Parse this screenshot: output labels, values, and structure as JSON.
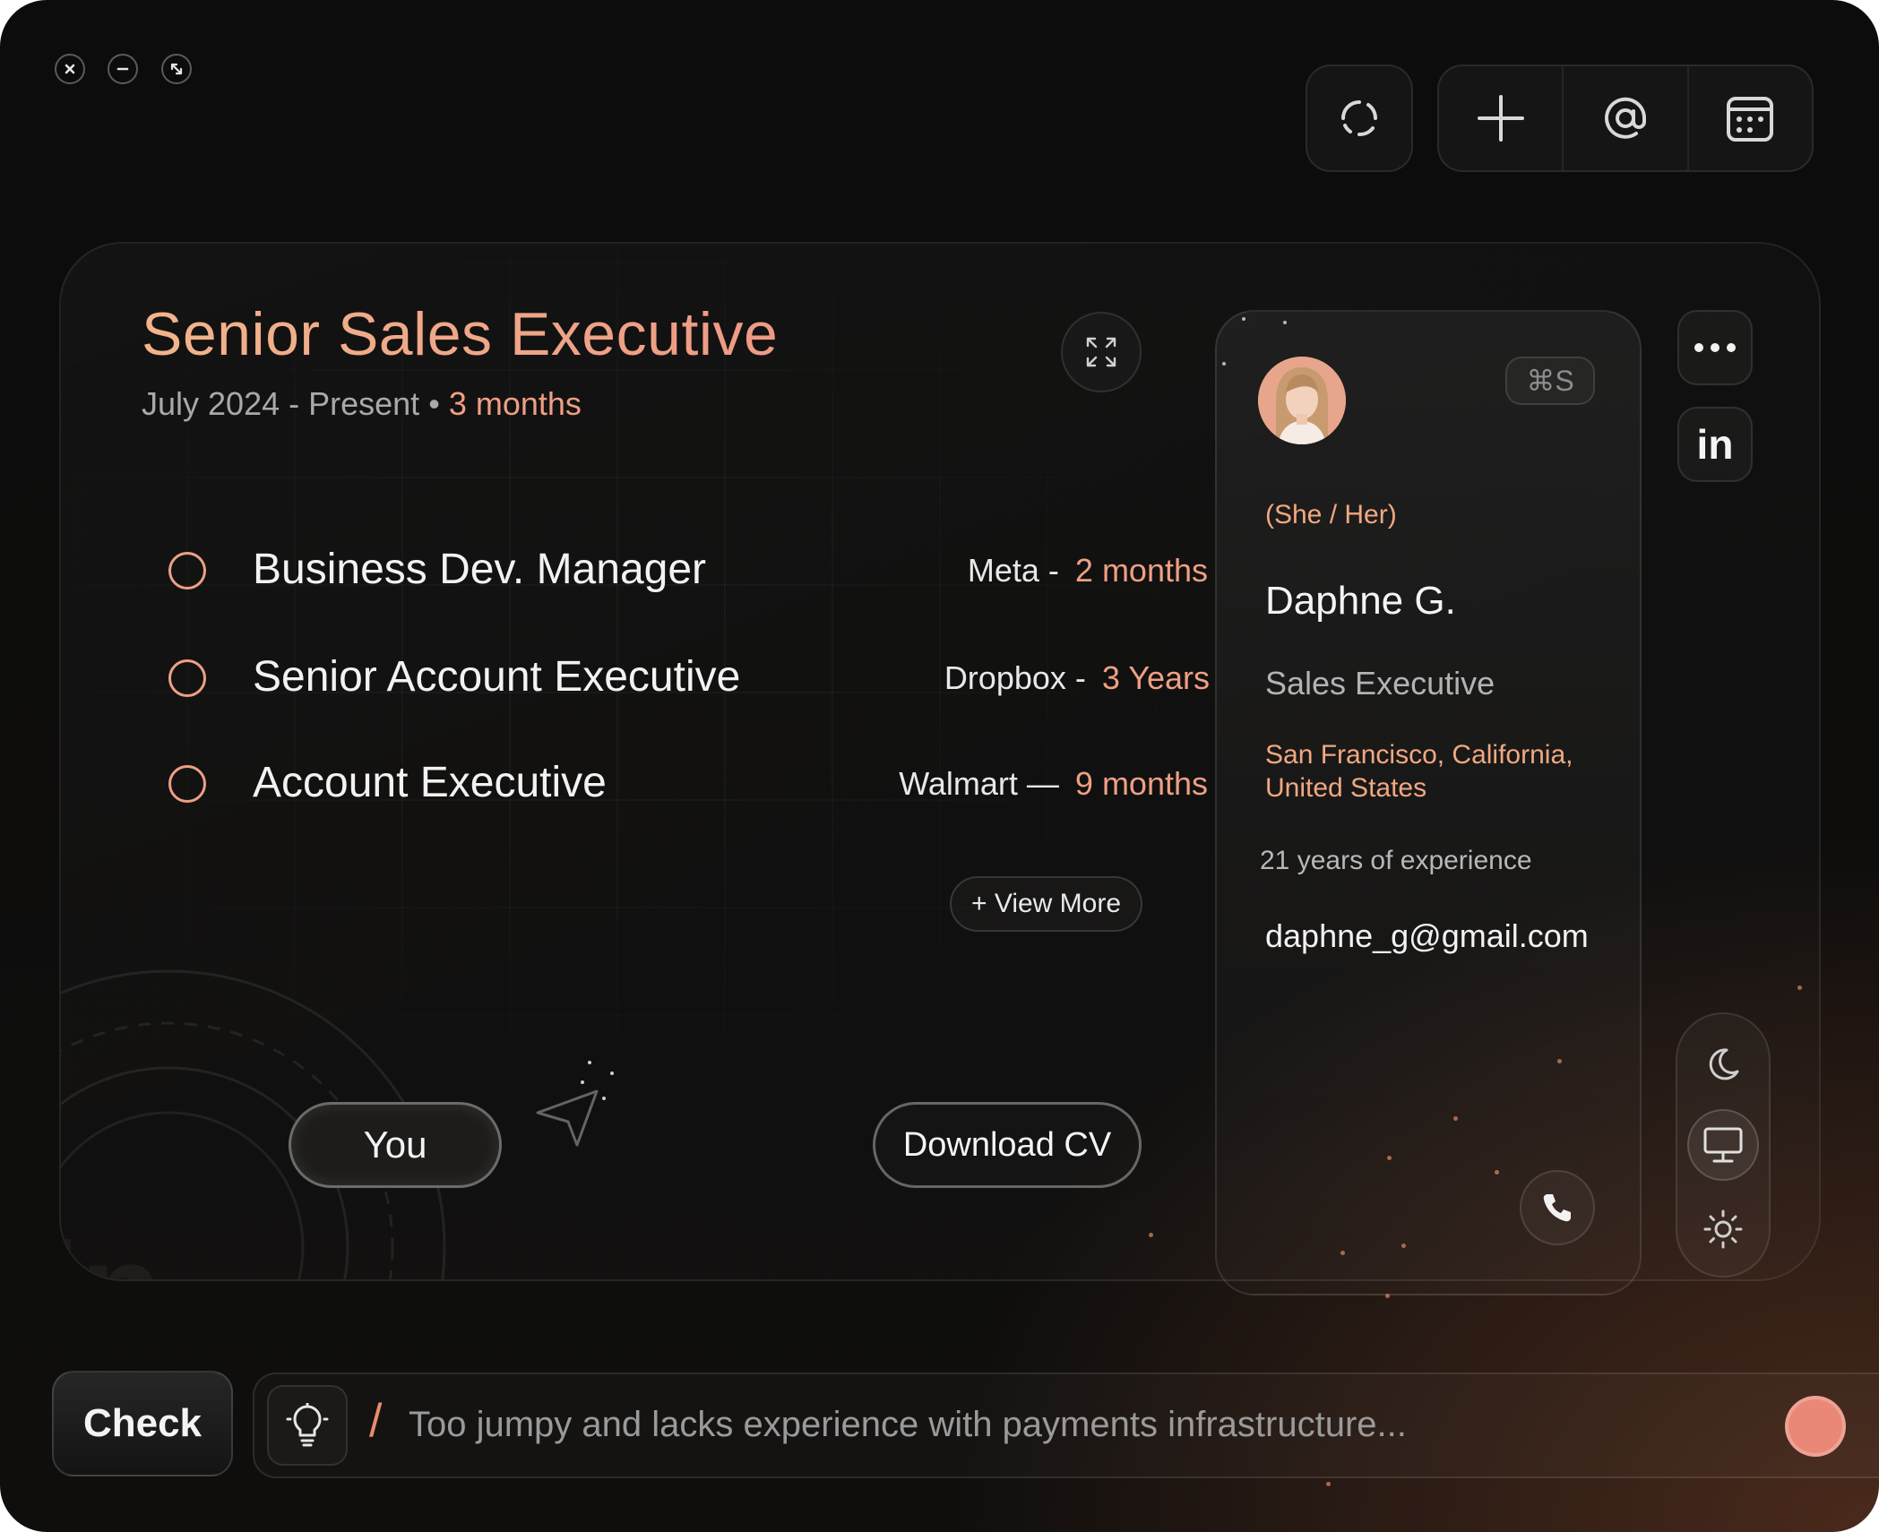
{
  "window": {
    "controls": [
      "close",
      "minimize",
      "fullscreen"
    ]
  },
  "toolbar": {
    "items": [
      {
        "icon": "refresh-icon"
      },
      {
        "icon": "plus-icon"
      },
      {
        "icon": "at-icon"
      },
      {
        "icon": "calendar-icon"
      }
    ]
  },
  "current_role": {
    "title": "Senior Sales Executive",
    "dates": "July 2024 - Present",
    "separator": "•",
    "duration": "3 months"
  },
  "experience": [
    {
      "role": "Business Dev. Manager",
      "company": "Meta -",
      "duration": "2 months"
    },
    {
      "role": "Senior Account Executive",
      "company": "Dropbox -",
      "duration": "3 Years"
    },
    {
      "role": "Account Executive",
      "company": "Walmart —",
      "duration": "9 months"
    }
  ],
  "actions": {
    "view_more": "+ View More",
    "you": "You",
    "download_cv": "Download CV"
  },
  "profile": {
    "shortcut": "⌘S",
    "pronouns": "(She / Her)",
    "name": "Daphne G.",
    "title": "Sales Executive",
    "location": "San Francisco, California, United States",
    "experience": "21 years of experience",
    "email": "daphne_g@gmail.com"
  },
  "side_actions": {
    "more_icon": "more-icon",
    "linkedin_label": "in"
  },
  "theme": {
    "options": [
      "dark",
      "system",
      "light"
    ],
    "selected": "system"
  },
  "bottom_bar": {
    "check_label": "Check",
    "slash": "/",
    "input_value": "Too jumpy and lacks experience with payments infrastructure..."
  },
  "colors": {
    "accent": "#EF9F83",
    "record": "#E98877",
    "background": "#0C0C0C"
  }
}
